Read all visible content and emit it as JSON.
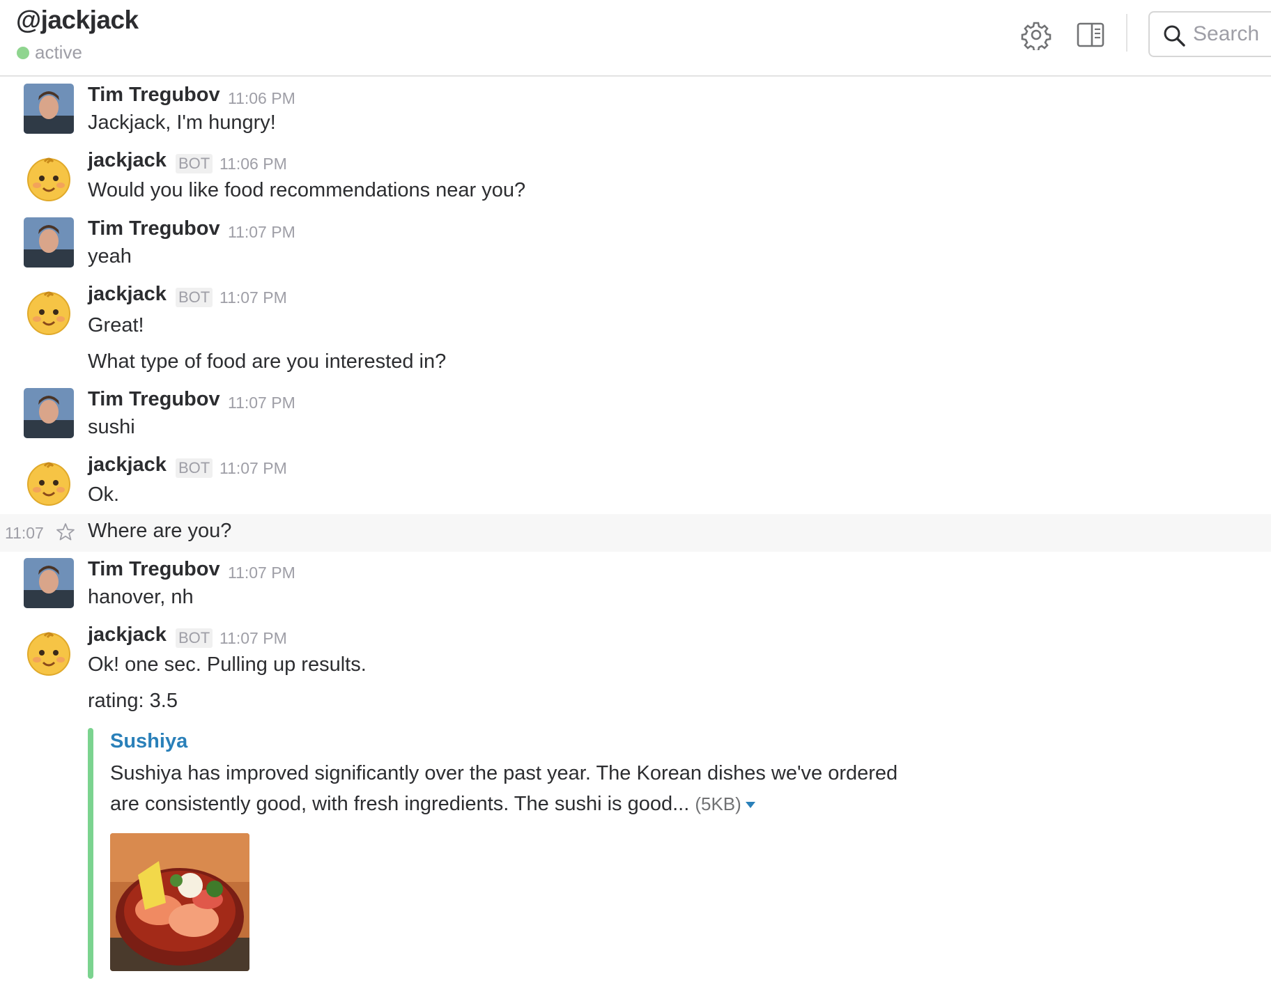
{
  "header": {
    "title": "@jackjack",
    "presence": "active",
    "settings_icon": "gear-icon",
    "sidebar_icon": "sidebar-toggle-icon",
    "search": {
      "placeholder": "Search",
      "value": "",
      "icon": "search-icon"
    }
  },
  "colors": {
    "presence": "#8fd58f",
    "link": "#2a80b9",
    "attachment_bar": "#7bd38f",
    "hover_row": "#f7f7f7"
  },
  "messages": [
    {
      "author": "Tim Tregubov",
      "time": "11:06 PM",
      "lines": [
        "Jackjack, I'm hungry!"
      ]
    },
    {
      "author": "jackjack",
      "badge": "BOT",
      "time": "11:06 PM",
      "lines": [
        "Would you like food recommendations near you?"
      ]
    },
    {
      "author": "Tim Tregubov",
      "time": "11:07 PM",
      "lines": [
        "yeah"
      ]
    },
    {
      "author": "jackjack",
      "badge": "BOT",
      "time": "11:07 PM",
      "lines": [
        "Great!",
        "What type of food are you interested in?"
      ]
    },
    {
      "author": "Tim Tregubov",
      "time": "11:07 PM",
      "lines": [
        "sushi"
      ]
    },
    {
      "author": "jackjack",
      "badge": "BOT",
      "time": "11:07 PM",
      "lines": [
        "Ok."
      ]
    },
    {
      "hover_time": "11:07",
      "star_icon": "star-icon",
      "lines": [
        "Where are you?"
      ]
    },
    {
      "author": "Tim Tregubov",
      "time": "11:07 PM",
      "lines": [
        "hanover, nh"
      ]
    },
    {
      "author": "jackjack",
      "badge": "BOT",
      "time": "11:07 PM",
      "lines": [
        "Ok! one sec. Pulling up results.",
        "rating: 3.5"
      ]
    }
  ],
  "attachment": {
    "title": "Sushiya",
    "body": "Sushiya has improved significantly over the past year. The Korean dishes we've ordered are consistently good, with fresh ingredients. The sushi is good...",
    "size": "(5KB)",
    "expand_icon": "caret-down-icon",
    "image": "sushi-bowl-photo"
  }
}
